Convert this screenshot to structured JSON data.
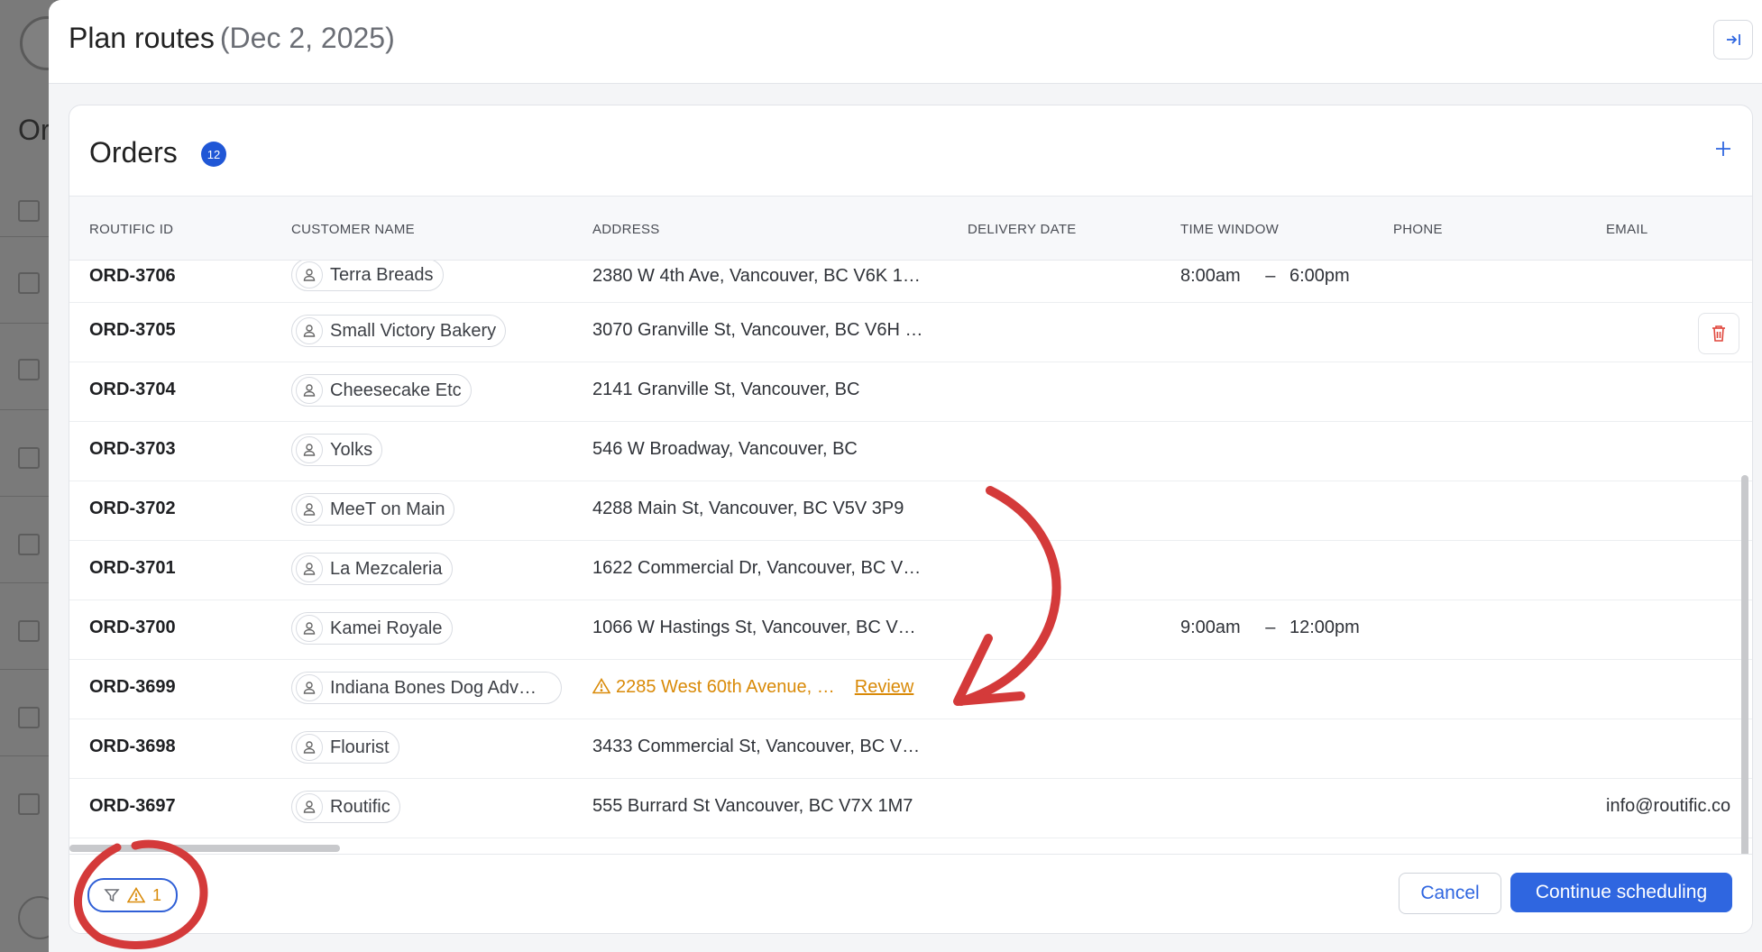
{
  "header": {
    "title": "Plan routes",
    "date": "(Dec 2, 2025)"
  },
  "background": {
    "title_fragment": "Or"
  },
  "orders": {
    "title": "Orders",
    "count": "12",
    "columns": [
      "ROUTIFIC ID",
      "CUSTOMER NAME",
      "ADDRESS",
      "DELIVERY DATE",
      "TIME WINDOW",
      "PHONE",
      "EMAIL"
    ],
    "rows": [
      {
        "id": "ORD-3706",
        "customer": "Terra Breads",
        "address": "2380 W 4th Ave, Vancouver, BC V6K 1…",
        "tw_start": "8:00am",
        "tw_sep": "–",
        "tw_end": "6:00pm",
        "email": ""
      },
      {
        "id": "ORD-3705",
        "customer": "Small Victory Bakery",
        "address": "3070 Granville St, Vancouver, BC V6H …",
        "tw_start": "",
        "tw_sep": "",
        "tw_end": "",
        "email": ""
      },
      {
        "id": "ORD-3704",
        "customer": "Cheesecake Etc",
        "address": "2141 Granville St, Vancouver, BC",
        "tw_start": "",
        "tw_sep": "",
        "tw_end": "",
        "email": ""
      },
      {
        "id": "ORD-3703",
        "customer": "Yolks",
        "address": "546 W Broadway, Vancouver, BC",
        "tw_start": "",
        "tw_sep": "",
        "tw_end": "",
        "email": ""
      },
      {
        "id": "ORD-3702",
        "customer": "MeeT on Main",
        "address": "4288 Main St, Vancouver, BC V5V 3P9",
        "tw_start": "",
        "tw_sep": "",
        "tw_end": "",
        "email": ""
      },
      {
        "id": "ORD-3701",
        "customer": "La Mezcaleria",
        "address": "1622 Commercial Dr, Vancouver, BC V…",
        "tw_start": "",
        "tw_sep": "",
        "tw_end": "",
        "email": ""
      },
      {
        "id": "ORD-3700",
        "customer": "Kamei Royale",
        "address": "1066 W Hastings St, Vancouver, BC V…",
        "tw_start": "9:00am",
        "tw_sep": "–",
        "tw_end": "12:00pm",
        "email": ""
      },
      {
        "id": "ORD-3699",
        "customer": "Indiana Bones Dog Adv…",
        "address": "2285 West 60th Avenue, …",
        "review": "Review",
        "tw_start": "",
        "tw_sep": "",
        "tw_end": "",
        "email": ""
      },
      {
        "id": "ORD-3698",
        "customer": "Flourist",
        "address": "3433 Commercial St, Vancouver, BC V…",
        "tw_start": "",
        "tw_sep": "",
        "tw_end": "",
        "email": ""
      },
      {
        "id": "ORD-3697",
        "customer": "Routific",
        "address": "555 Burrard St Vancouver, BC V7X 1M7",
        "tw_start": "",
        "tw_sep": "",
        "tw_end": "",
        "email": "info@routific.co"
      }
    ]
  },
  "footer": {
    "warning_count": "1",
    "cancel_label": "Cancel",
    "continue_label": "Continue scheduling"
  },
  "colors": {
    "accent": "#2f66e0",
    "badge": "#2057d6",
    "warning": "#d98a08",
    "annotation": "#d43a3a",
    "delete": "#e0463c"
  },
  "icons": [
    "collapse-panel-icon",
    "plus-icon",
    "person-icon",
    "warning-icon",
    "trash-icon",
    "filter-icon"
  ]
}
